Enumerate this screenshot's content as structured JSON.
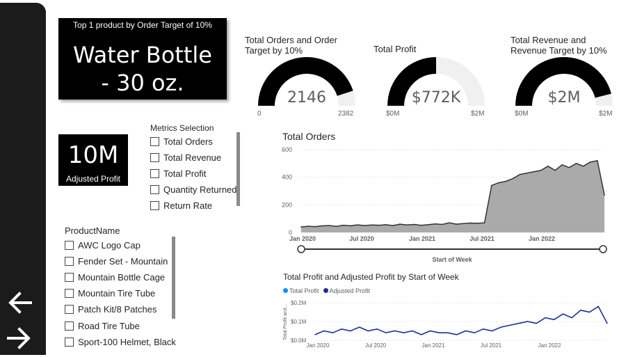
{
  "nav": {
    "back_icon": "arrow-left-icon",
    "forward_icon": "arrow-right-icon"
  },
  "top_product": {
    "title": "Top 1 product by Order Target of 10%",
    "value_line1": "Water Bottle",
    "value_line2": "- 30 oz."
  },
  "adjusted_profit": {
    "value": "10M",
    "label": "Adjusted Profit"
  },
  "metrics_slicer": {
    "title": "Metrics Selection",
    "items": [
      "Total Orders",
      "Total Revenue",
      "Total Profit",
      "Quantity Returned",
      "Return Rate"
    ]
  },
  "product_slicer": {
    "title": "ProductName",
    "items": [
      "AWC Logo Cap",
      "Fender Set - Mountain",
      "Mountain Bottle Cage",
      "Mountain Tire Tube",
      "Patch Kit/8 Patches",
      "Road Tire Tube",
      "Sport-100 Helmet, Black"
    ]
  },
  "gauges": [
    {
      "title_line1": "Total Orders and Order",
      "title_line2": "Target by 10%",
      "value": "2146",
      "min": "0",
      "max": "2382",
      "fill_fraction": 0.9
    },
    {
      "title_line1": "Total Profit",
      "title_line2": "",
      "value": "$772K",
      "min": "$0M",
      "max": "$2M",
      "fill_fraction": 0.5
    },
    {
      "title_line1": "Total Revenue and",
      "title_line2": "Revenue Target by 10%",
      "value": "$2M",
      "min": "$0M",
      "max": "$2M",
      "fill_fraction": 0.92
    }
  ],
  "colors": {
    "area_fill": "#aaaaaa",
    "area_line": "#333333",
    "adjusted_profit": "#1f2d9a",
    "total_profit": "#118dff",
    "gauge_fill": "#000000",
    "gauge_bg": "#f0f0f0"
  },
  "chart_data": [
    {
      "type": "area",
      "title": "Total Orders",
      "xlabel": "Start of Week",
      "ylabel": "",
      "ylim": [
        0,
        600
      ],
      "y_ticks": [
        "0",
        "200",
        "400",
        "600"
      ],
      "x_ticks": [
        "Jan 2020",
        "Jul 2020",
        "Jan 2021",
        "Jul 2021",
        "Jan 2022"
      ],
      "x": [
        "2020-01-06",
        "2020-01-27",
        "2020-02-17",
        "2020-03-09",
        "2020-03-30",
        "2020-04-20",
        "2020-05-11",
        "2020-06-01",
        "2020-06-22",
        "2020-07-13",
        "2020-08-03",
        "2020-08-24",
        "2020-09-14",
        "2020-10-05",
        "2020-10-26",
        "2020-11-16",
        "2020-12-07",
        "2020-12-28",
        "2021-01-18",
        "2021-02-08",
        "2021-03-01",
        "2021-03-22",
        "2021-04-12",
        "2021-05-03",
        "2021-05-24",
        "2021-06-14",
        "2021-07-05",
        "2021-07-26",
        "2021-08-16",
        "2021-09-06",
        "2021-09-27",
        "2021-10-18",
        "2021-11-08",
        "2021-11-29",
        "2021-12-20",
        "2022-01-10",
        "2022-01-31",
        "2022-02-21",
        "2022-03-14",
        "2022-04-04",
        "2022-04-25",
        "2022-05-16",
        "2022-06-06",
        "2022-06-27"
      ],
      "series": [
        {
          "name": "Total Orders",
          "values": [
            40,
            45,
            42,
            48,
            50,
            44,
            52,
            48,
            55,
            50,
            54,
            52,
            56,
            50,
            60,
            54,
            58,
            52,
            56,
            62,
            58,
            70,
            60,
            64,
            68,
            66,
            70,
            340,
            360,
            370,
            390,
            420,
            430,
            440,
            450,
            480,
            450,
            490,
            470,
            500,
            480,
            510,
            520,
            270
          ]
        }
      ]
    },
    {
      "type": "line",
      "title": "Total Profit and Adjusted Profit by Start of Week",
      "xlabel": "",
      "ylabel": "Total Profit and...",
      "ylim": [
        0,
        0.2
      ],
      "y_ticks": [
        "$0.0M",
        "$0.1M",
        "$0.2M"
      ],
      "x_ticks": [
        "Jan 2020",
        "Jul 2020",
        "Jan 2021",
        "Jul 2021",
        "Jan 2022"
      ],
      "x": [
        "2020-01-06",
        "2020-02-03",
        "2020-03-02",
        "2020-03-30",
        "2020-04-27",
        "2020-05-25",
        "2020-06-22",
        "2020-07-20",
        "2020-08-17",
        "2020-09-14",
        "2020-10-12",
        "2020-11-09",
        "2020-12-07",
        "2021-01-04",
        "2021-02-01",
        "2021-03-01",
        "2021-03-29",
        "2021-04-26",
        "2021-05-24",
        "2021-06-21",
        "2021-07-19",
        "2021-08-16",
        "2021-09-13",
        "2021-10-11",
        "2021-11-08",
        "2021-12-06",
        "2022-01-03",
        "2022-01-31",
        "2022-02-28",
        "2022-03-28",
        "2022-04-25",
        "2022-05-23",
        "2022-06-20",
        "2022-07-04"
      ],
      "legend": [
        "Total Profit",
        "Adjusted Profit"
      ],
      "series": [
        {
          "name": "Total Profit",
          "values": []
        },
        {
          "name": "Adjusted Profit",
          "values": [
            0.03,
            0.05,
            0.04,
            0.06,
            0.05,
            0.07,
            0.05,
            0.06,
            0.04,
            0.05,
            0.04,
            0.05,
            0.03,
            0.05,
            0.04,
            0.04,
            0.03,
            0.05,
            0.04,
            0.06,
            0.05,
            0.07,
            0.08,
            0.09,
            0.1,
            0.09,
            0.12,
            0.11,
            0.14,
            0.12,
            0.16,
            0.15,
            0.18,
            0.09
          ]
        }
      ]
    }
  ]
}
